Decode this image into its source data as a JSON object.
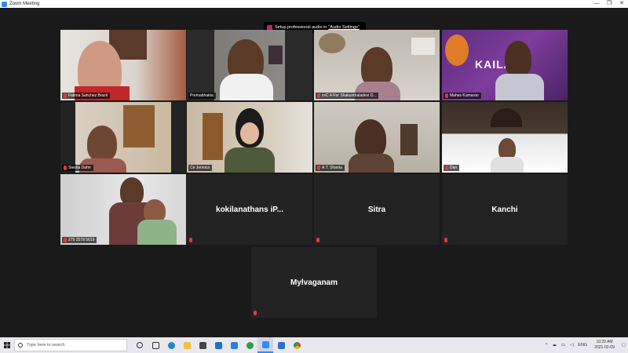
{
  "window": {
    "title": "Zoom Meeting",
    "controls": {
      "minimize": "—",
      "restore": "❐",
      "close": "✕"
    }
  },
  "audio_banner": {
    "text": "Setup professional audio in",
    "link": "\"Audio Settings\""
  },
  "participants": [
    {
      "name": "Fatima Sanchez Brazil",
      "video": true,
      "muted": true
    },
    {
      "name": "Premabhakta",
      "video": true,
      "muted": false,
      "active_speaker": true
    },
    {
      "name": "xxC A Rsr Shakunthaladevi D...",
      "video": true,
      "muted": true
    },
    {
      "name": "Mahes Kumaran",
      "video": true,
      "muted": true,
      "banner_text": "KAILASA"
    },
    {
      "name": "Siesha Dahn",
      "video": true,
      "muted": true
    },
    {
      "name": "Ce Jennica",
      "video": true,
      "muted": false
    },
    {
      "name": "A.T. Shanta",
      "video": true,
      "muted": true
    },
    {
      "name": "Dan",
      "video": true,
      "muted": true
    },
    {
      "name": "279 2578 5619",
      "video": true,
      "muted": true
    },
    {
      "name": "kokilanathans iP...",
      "video": false,
      "muted": true
    },
    {
      "name": "Sitra",
      "video": false,
      "muted": true
    },
    {
      "name": "Kanchi",
      "video": false,
      "muted": true
    },
    {
      "name": "Mylvaganam",
      "video": false,
      "muted": true
    }
  ],
  "taskbar": {
    "search_placeholder": "Type here to search",
    "tray_lang": "ENG",
    "time": "10:29 AM",
    "date": "2021-02-09",
    "tray_chevron": "^",
    "tray_icons": [
      "cloud-icon",
      "network-icon",
      "volume-icon"
    ]
  },
  "colors": {
    "zoom_blue": "#2d8cff",
    "active_outline": "#d9e36b",
    "muted_red": "#e53935",
    "tile_bg": "#232323"
  }
}
